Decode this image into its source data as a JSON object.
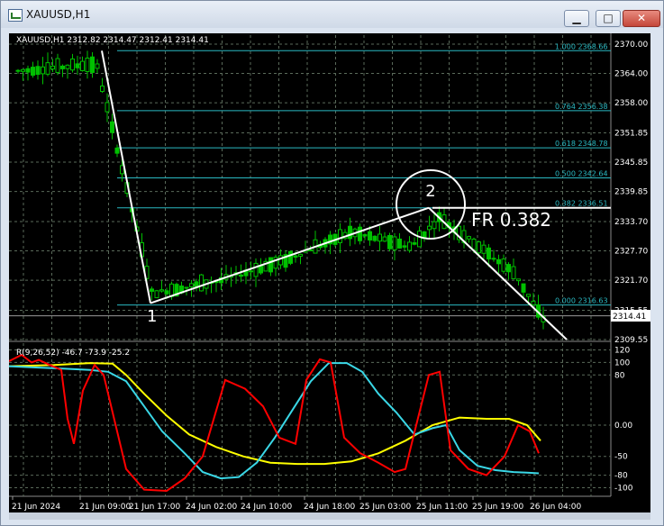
{
  "window": {
    "title": "XAUUSD,H1",
    "minimize_label": "▁",
    "maximize_label": "□",
    "close_label": "✕"
  },
  "chart": {
    "header": "XAUUSD,H1  2312.82 2314.47 2312.41 2314.41",
    "current_price": "2314.41",
    "price_ticks": [
      "2370.00",
      "2364.00",
      "2358.00",
      "2351.85",
      "2345.85",
      "2339.85",
      "2333.70",
      "2327.70",
      "2321.70",
      "2315.55",
      "2309.55"
    ],
    "fib_levels": [
      {
        "ratio": "1.000",
        "price": "2368.66"
      },
      {
        "ratio": "0.764",
        "price": "2356.38"
      },
      {
        "ratio": "0.618",
        "price": "2348.78"
      },
      {
        "ratio": "0.500",
        "price": "2342.64"
      },
      {
        "ratio": "0.382",
        "price": "2336.51"
      },
      {
        "ratio": "0.000",
        "price": "2316.63"
      }
    ],
    "point1_label": "1",
    "point2_label": "2",
    "annotation": "FR 0.382",
    "indicator_header": "R(9,26,52) -46.7 -73.9 -25.2",
    "indicator_ticks": [
      "120",
      "100",
      "80",
      "0.00",
      "-50",
      "-80",
      "-100"
    ],
    "time_labels": [
      "21 Jun 2024",
      "21 Jun 09:00",
      "21 Jun 17:00",
      "24 Jun 02:00",
      "24 Jun 10:00",
      "24 Jun 18:00",
      "25 Jun 03:00",
      "25 Jun 11:00",
      "25 Jun 19:00",
      "26 Jun 04:00"
    ],
    "colors": {
      "up": "#00c000",
      "down": "#00c000",
      "fib": "#2ab9c2",
      "red": "#ff0000",
      "cyan": "#3ad7e6",
      "yellow": "#ffff00"
    }
  },
  "chart_data": {
    "type": "line",
    "x": [
      "21 Jun 2024",
      "21 Jun 09:00",
      "21 Jun 17:00",
      "24 Jun 02:00",
      "24 Jun 10:00",
      "24 Jun 18:00",
      "25 Jun 03:00",
      "25 Jun 11:00",
      "25 Jun 19:00",
      "26 Jun 04:00"
    ],
    "ylim": [
      2309.55,
      2370.0
    ],
    "grid": true,
    "series": [
      {
        "values": [
          2364.5,
          2366.0,
          2319.0,
          2321.5,
          2325.5,
          2331.5,
          2328.5,
          2334.5,
          2323.0,
          2313.8
        ]
      }
    ]
  }
}
